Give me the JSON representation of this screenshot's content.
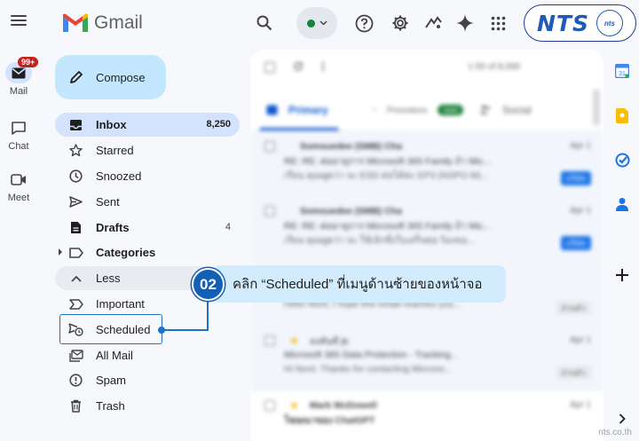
{
  "rail": {
    "mail_label": "Mail",
    "mail_badge": "99+",
    "chat_label": "Chat",
    "meet_label": "Meet"
  },
  "header": {
    "app_name": "Gmail",
    "status": "active",
    "brand_text": "NTS",
    "brand_small": "nts"
  },
  "compose_label": "Compose",
  "nav": {
    "inbox": {
      "label": "Inbox",
      "count": "8,250"
    },
    "starred": {
      "label": "Starred"
    },
    "snoozed": {
      "label": "Snoozed"
    },
    "sent": {
      "label": "Sent"
    },
    "drafts": {
      "label": "Drafts",
      "count": "4"
    },
    "categories": {
      "label": "Categories"
    },
    "less": {
      "label": "Less"
    },
    "important": {
      "label": "Important"
    },
    "scheduled": {
      "label": "Scheduled"
    },
    "all_mail": {
      "label": "All Mail"
    },
    "spam": {
      "label": "Spam"
    },
    "trash": {
      "label": "Trash"
    }
  },
  "main": {
    "count_text": "1-50 of 8,000",
    "tabs": [
      {
        "label": "Primary"
      },
      {
        "label": "Promotions",
        "chip": "new"
      },
      {
        "label": "Social"
      }
    ],
    "rows": [
      {
        "sender": "Somsuedee (SMB) Cha",
        "subject": "RE: RE: ต่ออายุการ Microsoft 365 Family ถ้า Mic...",
        "snippet": "เรียน คุณพูดว่า จะ ESD ต่อได้ค่ะ EP3 (NSPO M)...",
        "date": "Apr 1",
        "tag": "บริษัท"
      },
      {
        "sender": "Somsuedee (SMB) Cha",
        "subject": "RE: RE: ต่ออายุการ Microsoft 365 Family ถ้า Mic...",
        "snippet": "เรียน คุณพูดว่า จะ ใช้เลิกซึ่งใบเสร็จต่อ ร้องขอ...",
        "date": "Apr 1",
        "tag": "บริษัท"
      },
      {
        "sender": "",
        "subject": "",
        "snippet": "Hello Nont, I hope this email reaches you...",
        "date": "",
        "tag": "ส่วนตัว"
      },
      {
        "sender": "ลงทันที jb",
        "subject": "Microsoft 365 Data Protection - Tracking...",
        "snippet": "Hi Nont, Thanks for contacting Microso...",
        "date": "Apr 1",
        "tag": "ส่วนตัว"
      },
      {
        "sender": "Mark McDowell",
        "subject": "โฆษณาของ ChatGPT",
        "snippet": "",
        "date": "Apr 1",
        "tag": ""
      }
    ]
  },
  "callout": {
    "number": "02",
    "text": "คลิก “Scheduled” ที่เมนูด้านซ้ายของหน้าจอ"
  },
  "watermark": "nts.co.th",
  "colors": {
    "accent": "#1160b5",
    "compose_bg": "#c2e7ff",
    "active_nav": "#d3e3fd",
    "brand": "#1e5bb8"
  }
}
